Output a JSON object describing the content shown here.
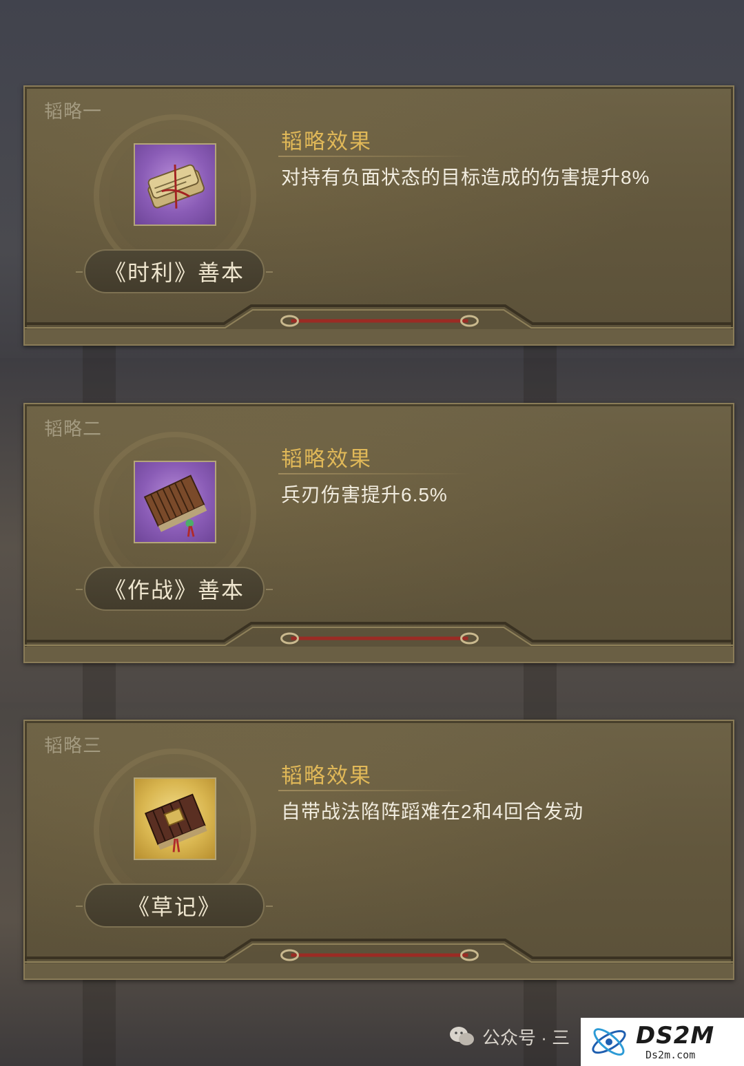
{
  "cards": [
    {
      "label": "韬略一",
      "icon": "scroll-bundle-icon",
      "icon_bg": "#8a5cb6",
      "book_name": "《时利》善本",
      "effect_title": "韬略效果",
      "effect_text": "对持有负面状态的目标造成的伤害提升8%"
    },
    {
      "label": "韬略二",
      "icon": "bamboo-slips-icon",
      "icon_bg": "#8a5cb6",
      "book_name": "《作战》善本",
      "effect_title": "韬略效果",
      "effect_text": "兵刃伤害提升6.5%"
    },
    {
      "label": "韬略三",
      "icon": "bound-book-icon",
      "icon_bg": "#d9b650",
      "book_name": "《草记》",
      "effect_title": "韬略效果",
      "effect_text": "自带战法陷阵蹈难在2和4回合发动"
    }
  ],
  "colors": {
    "effect_title": "#e0b858",
    "label": "#a39a80",
    "card_bg": "#62573d",
    "rope": "#9b2b24"
  },
  "watermark": {
    "icon": "wechat-icon",
    "text": "公众号 · 三"
  },
  "logo": {
    "big": "DS2M",
    "small": "Ds2m.com"
  }
}
